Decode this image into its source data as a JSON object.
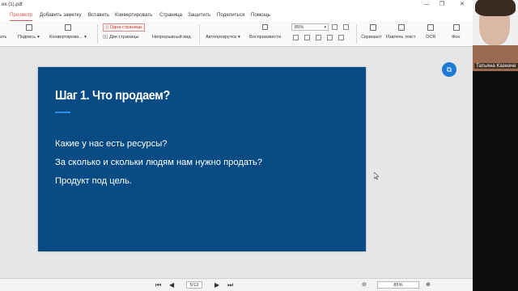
{
  "window": {
    "title": "ия (1).pdf",
    "controls": [
      "—",
      "❐",
      "✕"
    ]
  },
  "menu": {
    "items": [
      "Просмотр",
      "Добавить заметку",
      "Вставить",
      "Конвертировать",
      "Страница",
      "Защитить",
      "Поделиться",
      "Помощь"
    ],
    "active": "Просмотр"
  },
  "toolbar": {
    "hand_label": "ать",
    "signature_label": "Подпись",
    "convert_label": "Конвертирова...",
    "one_page_label": "Одна страница",
    "two_pages_label": "Две страницы",
    "continuous_label": "Непрерывный вид",
    "autoscroll_label": "Автопрокрутка",
    "play_label": "Воспроизвести",
    "zoom_value": "85%",
    "screenshot_label": "Скриншот",
    "extract_text_label": "Извлечь текст",
    "ocr_label": "OCR",
    "background_label": "Фон"
  },
  "slide": {
    "title": "Шаг 1. Что продаем?",
    "lines": [
      "Какие у нас есть ресурсы?",
      "За сколько и скольки людям нам нужно продать?",
      "Продукт под цель."
    ]
  },
  "status": {
    "page": "5/12",
    "zoom": "85%"
  },
  "webcam": {
    "name": "Татьяна Казначе"
  },
  "colors": {
    "slide_bg": "#064b84",
    "accent": "#2f8fe0",
    "menu_active": "#d9534f"
  }
}
